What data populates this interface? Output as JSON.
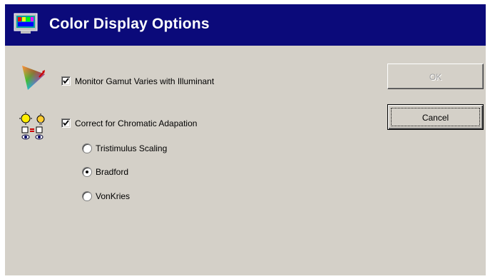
{
  "window": {
    "title": "Color Display Options",
    "title_icon": "monitor-icon"
  },
  "options": {
    "monitor_gamut": {
      "label": "Monitor Gamut Varies with Illuminant",
      "checked": true,
      "icon": "color-gamut-icon"
    },
    "chromatic_adaptation": {
      "label": "Correct for Chromatic Adapation",
      "checked": true,
      "icon": "chromatic-adaptation-icon"
    },
    "methods": [
      {
        "label": "Tristimulus Scaling",
        "selected": false
      },
      {
        "label": "Bradford",
        "selected": true
      },
      {
        "label": "VonKries",
        "selected": false
      }
    ]
  },
  "buttons": {
    "ok_label": "OK",
    "ok_enabled": false,
    "cancel_label": "Cancel"
  },
  "colors": {
    "titlebar": "#0b0a7a",
    "dialog_bg": "#d4d0c8"
  }
}
